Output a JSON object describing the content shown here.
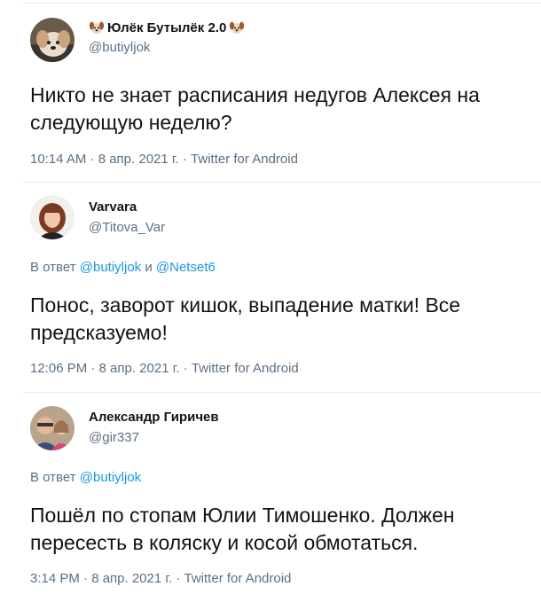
{
  "tweets": [
    {
      "display_name": "Юлёк Бутылёк 2.0",
      "name_emoji": "dog-face-emoji",
      "handle": "@butiyljok",
      "text": "Никто не знает расписания недугов Алексея на следующую неделю?",
      "meta": "10:14 AM · 8 апр. 2021 г. · Twitter for Android"
    },
    {
      "display_name": "Varvara",
      "handle": "@Titova_Var",
      "reply_prefix": "В ответ",
      "reply_to_1": "@butiyljok",
      "reply_joiner": "и",
      "reply_to_2": "@Netset6",
      "text": "Понос, заворот кишок, выпадение матки! Все предсказуемо!",
      "meta": "12:06 PM · 8 апр. 2021 г. · Twitter for Android"
    },
    {
      "display_name": "Александр Гиричев",
      "handle": "@gir337",
      "reply_prefix": "В ответ",
      "reply_to_1": "@butiyljok",
      "text": "Пошёл по стопам Юлии Тимошенко. Должен пересесть в коляску и косой обмотаться.",
      "meta": "3:14 PM · 8 апр. 2021 г. · Twitter for Android"
    }
  ],
  "colors": {
    "text": "#0f1419",
    "secondary": "#5b7083",
    "link": "#1b95e0",
    "divider": "#e6ecf0"
  }
}
